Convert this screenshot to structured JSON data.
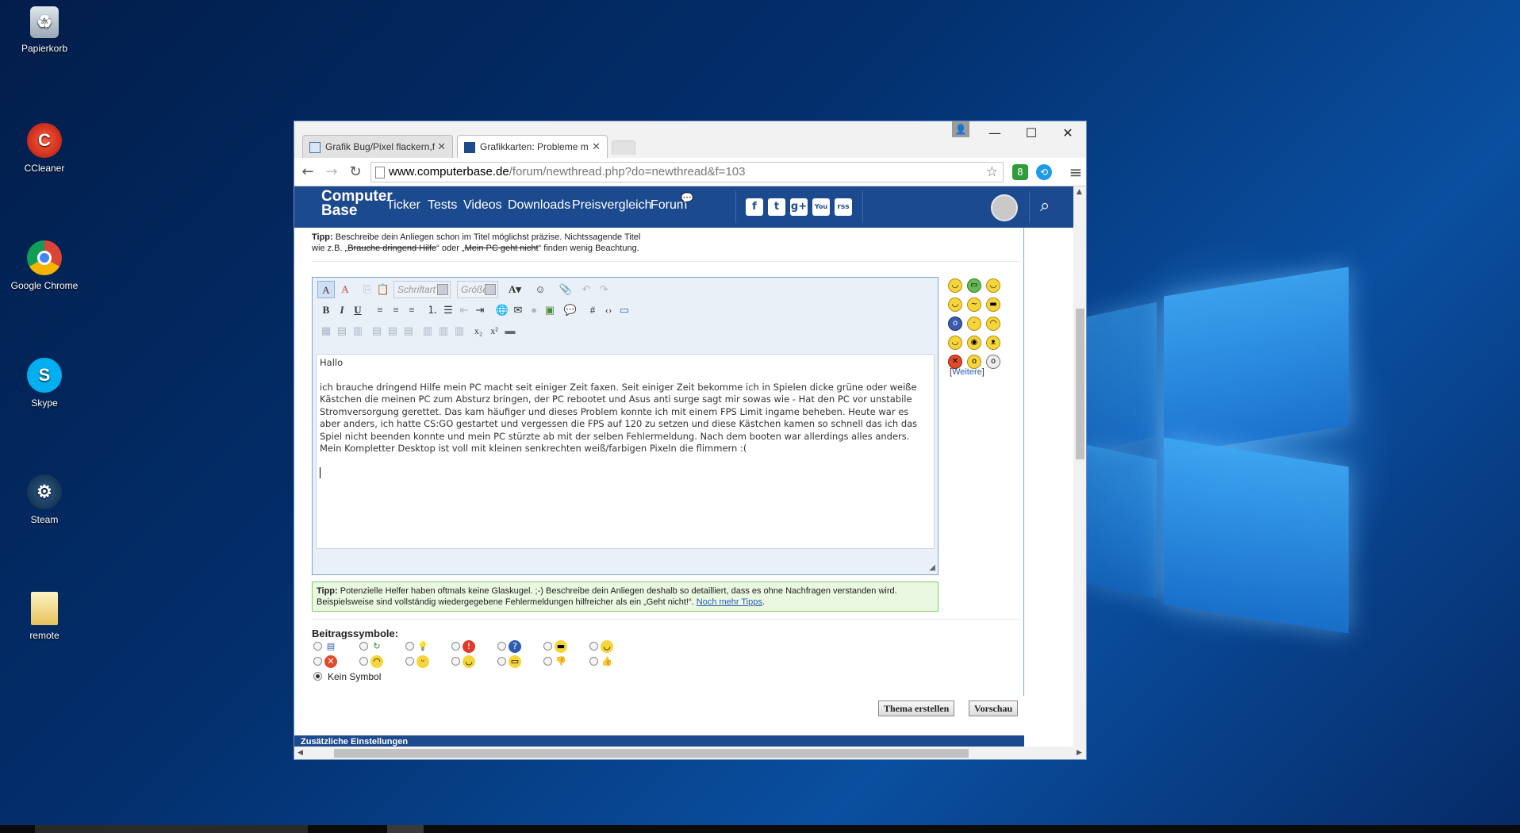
{
  "desktop": {
    "icons": [
      {
        "label": "Papierkorb",
        "icon": "recycle-bin-icon"
      },
      {
        "label": "CCleaner",
        "icon": "ccleaner-icon"
      },
      {
        "label": "Google Chrome",
        "icon": "chrome-icon"
      },
      {
        "label": "Skype",
        "icon": "skype-icon"
      },
      {
        "label": "Steam",
        "icon": "steam-icon"
      },
      {
        "label": "remote",
        "icon": "folder-icon"
      }
    ]
  },
  "browser": {
    "tabs": [
      {
        "label": "Grafik Bug/Pixel flackern,f"
      },
      {
        "label": "Grafikkarten: Probleme m"
      }
    ],
    "url_host": "www.computerbase.de",
    "url_path": "/forum/newthread.php?do=newthread&f=103",
    "ext_badge": "8"
  },
  "site": {
    "logo_line1": "Computer",
    "logo_line2": "Base",
    "nav": [
      "Ticker",
      "Tests",
      "Videos",
      "Downloads",
      "Preisvergleich",
      "Forum"
    ],
    "social": [
      "f",
      "t",
      "g+",
      "You",
      "rss"
    ],
    "accent": "#1c4a8e"
  },
  "form": {
    "tip_top_label": "Tipp:",
    "tip_top_text1": " Beschreibe dein Anliegen schon im Titel möglichst präzise. Nichtssagende Titel",
    "tip_top_text2a": "wie z.B. „",
    "tip_top_strike1": "Brauche dringend Hilfe",
    "tip_top_text2b": "“ oder „",
    "tip_top_strike2": "Mein PC geht nicht",
    "tip_top_text2c": "“ finden wenig Beachtung.",
    "font_select": "Schriftart",
    "size_select": "Größe",
    "message_greeting": "Hallo",
    "message_body": "ich brauche dringend Hilfe mein PC macht seit einiger Zeit faxen. Seit einiger Zeit bekomme ich in Spielen dicke grüne oder weiße Kästchen die meinen PC zum Absturz bringen, der PC rebootet und Asus anti surge sagt mir sowas wie - Hat den PC vor unstabile Stromversorgung gerettet. Das kam häufiger und dieses Problem konnte ich mit einem FPS Limit ingame beheben. Heute war es aber anders, ich hatte CS:GO gestartet und vergessen die FPS auf 120 zu setzen und diese Kästchen kamen so schnell das ich das Spiel nicht beenden konnte und mein PC stürzte ab mit der selben Fehlermeldung. Nach dem booten war allerdings alles anders. Mein Kompletter Desktop ist voll mit kleinen senkrechten weiß/farbigen Pixeln die flimmern :(",
    "weitere_open": "[",
    "weitere_link": "Weitere",
    "weitere_close": "]",
    "tip_bottom_label": "Tipp:",
    "tip_bottom_text": " Potenzielle Helfer haben oftmals keine Glaskugel. ;-) Beschreibe dein Anliegen deshalb so detailliert, dass es ohne Nachfragen verstanden wird. Beispielsweise sind vollständig wiedergegebene Fehlermeldungen hilfreicher als ein „Geht nicht!“. ",
    "tip_bottom_link": "Noch mehr Tipps",
    "tip_bottom_end": ".",
    "post_icons_label": "Beitragssymbole:",
    "no_symbol_label": "Kein Symbol",
    "submit_label": "Thema erstellen",
    "preview_label": "Vorschau",
    "extra_settings_label": "Zusätzliche Einstellungen"
  }
}
